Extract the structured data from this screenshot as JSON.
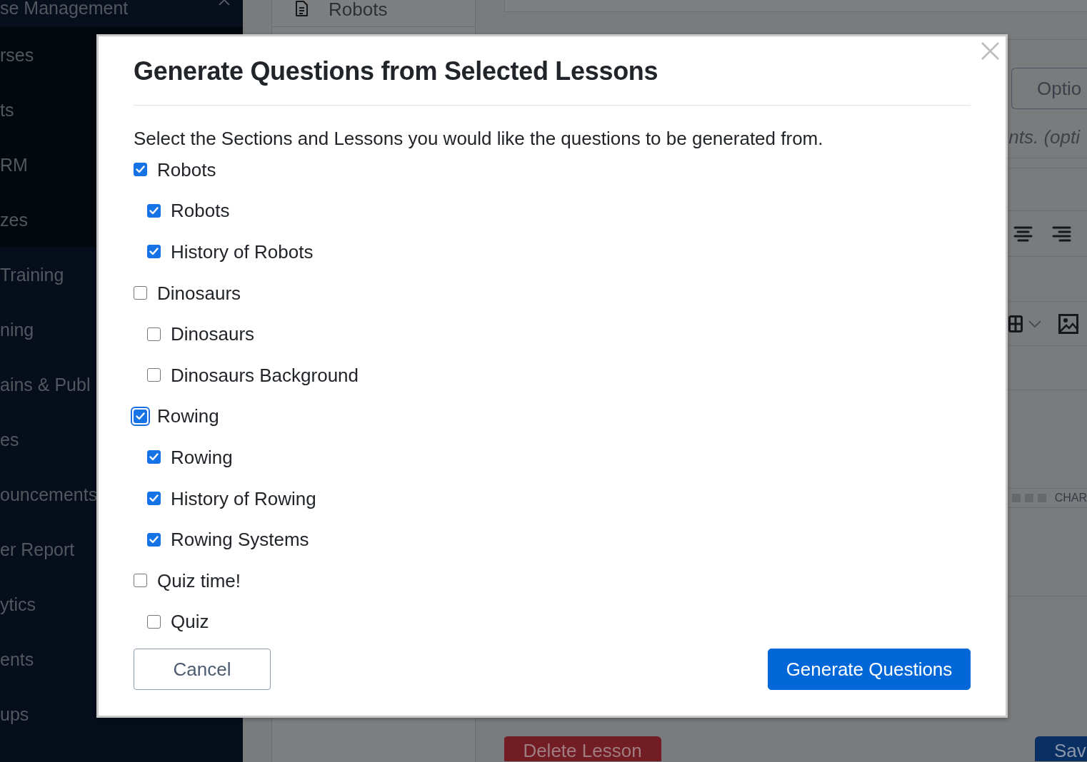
{
  "sidebar": {
    "title": "se Management",
    "submenu": [
      "rses",
      "ts",
      "RM",
      "zes"
    ],
    "items": [
      "Training",
      "ning",
      "ains & Publ",
      "es",
      "ouncements",
      "er Report",
      "ytics",
      "ents",
      "ups"
    ]
  },
  "lesson_list": {
    "items": [
      "Robots"
    ]
  },
  "editor": {
    "options_button": "Optio",
    "hint": "nts. (opti",
    "status_label": "CHAR"
  },
  "actions": [
    {
      "label": "Delete Lesson",
      "kind": "danger"
    },
    {
      "label": "Sav",
      "kind": "primary"
    }
  ],
  "modal": {
    "title": "Generate Questions from Selected Lessons",
    "instructions": "Select the Sections and Lessons you would like the questions to be generated from.",
    "sections": [
      {
        "label": "Robots",
        "checked": true,
        "focused": false,
        "children": [
          {
            "label": "Robots",
            "checked": true,
            "focused": false
          },
          {
            "label": "History of Robots",
            "checked": true,
            "focused": false
          }
        ]
      },
      {
        "label": "Dinosaurs",
        "checked": false,
        "focused": false,
        "children": [
          {
            "label": "Dinosaurs",
            "checked": false,
            "focused": false
          },
          {
            "label": "Dinosaurs Background",
            "checked": false,
            "focused": false
          }
        ]
      },
      {
        "label": "Rowing",
        "checked": true,
        "focused": true,
        "children": [
          {
            "label": "Rowing",
            "checked": true,
            "focused": false
          },
          {
            "label": "History of Rowing",
            "checked": true,
            "focused": false
          },
          {
            "label": "Rowing Systems",
            "checked": true,
            "focused": false
          }
        ]
      },
      {
        "label": "Quiz time!",
        "checked": false,
        "focused": false,
        "children": [
          {
            "label": "Quiz",
            "checked": false,
            "focused": false
          }
        ]
      }
    ],
    "buttons": [
      {
        "label": "Cancel",
        "kind": "secondary"
      },
      {
        "label": "Generate Questions",
        "kind": "primary"
      }
    ]
  }
}
